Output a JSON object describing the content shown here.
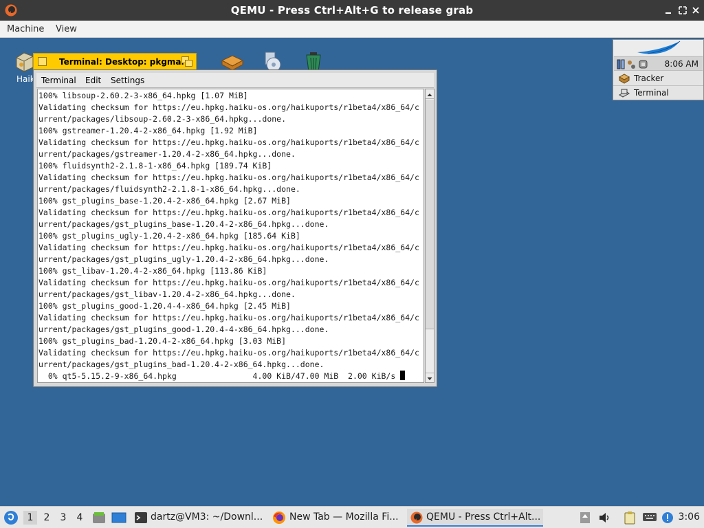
{
  "qemu": {
    "title": "QEMU - Press Ctrl+Alt+G to release grab",
    "menu": [
      "Machine",
      "View"
    ]
  },
  "desktop": {
    "icons": [
      {
        "name": "haiku-volume-icon",
        "label": "Haik"
      },
      {
        "name": "box-icon",
        "label": ""
      },
      {
        "name": "cd-icon",
        "label": ""
      },
      {
        "name": "trash-icon",
        "label": ""
      }
    ]
  },
  "terminal": {
    "title": "Terminal: Desktop: pkgman",
    "menu": [
      "Terminal",
      "Edit",
      "Settings"
    ],
    "lines": [
      "100% libsoup-2.60.2-3-x86_64.hpkg [1.07 MiB]",
      "Validating checksum for https://eu.hpkg.haiku-os.org/haikuports/r1beta4/x86_64/c",
      "urrent/packages/libsoup-2.60.2-3-x86_64.hpkg...done.",
      "100% gstreamer-1.20.4-2-x86_64.hpkg [1.92 MiB]",
      "Validating checksum for https://eu.hpkg.haiku-os.org/haikuports/r1beta4/x86_64/c",
      "urrent/packages/gstreamer-1.20.4-2-x86_64.hpkg...done.",
      "100% fluidsynth2-2.1.8-1-x86_64.hpkg [189.74 KiB]",
      "Validating checksum for https://eu.hpkg.haiku-os.org/haikuports/r1beta4/x86_64/c",
      "urrent/packages/fluidsynth2-2.1.8-1-x86_64.hpkg...done.",
      "100% gst_plugins_base-1.20.4-2-x86_64.hpkg [2.67 MiB]",
      "Validating checksum for https://eu.hpkg.haiku-os.org/haikuports/r1beta4/x86_64/c",
      "urrent/packages/gst_plugins_base-1.20.4-2-x86_64.hpkg...done.",
      "100% gst_plugins_ugly-1.20.4-2-x86_64.hpkg [185.64 KiB]",
      "Validating checksum for https://eu.hpkg.haiku-os.org/haikuports/r1beta4/x86_64/c",
      "urrent/packages/gst_plugins_ugly-1.20.4-2-x86_64.hpkg...done.",
      "100% gst_libav-1.20.4-2-x86_64.hpkg [113.86 KiB]",
      "Validating checksum for https://eu.hpkg.haiku-os.org/haikuports/r1beta4/x86_64/c",
      "urrent/packages/gst_libav-1.20.4-2-x86_64.hpkg...done.",
      "100% gst_plugins_good-1.20.4-4-x86_64.hpkg [2.45 MiB]",
      "Validating checksum for https://eu.hpkg.haiku-os.org/haikuports/r1beta4/x86_64/c",
      "urrent/packages/gst_plugins_good-1.20.4-4-x86_64.hpkg...done.",
      "100% gst_plugins_bad-1.20.4-2-x86_64.hpkg [3.03 MiB]",
      "Validating checksum for https://eu.hpkg.haiku-os.org/haikuports/r1beta4/x86_64/c",
      "urrent/packages/gst_plugins_bad-1.20.4-2-x86_64.hpkg...done.",
      "  0% qt5-5.15.2-9-x86_64.hpkg                4.00 KiB/47.00 MiB  2.00 KiB/s "
    ]
  },
  "deskbar": {
    "time": "8:06 AM",
    "items": [
      "Tracker",
      "Terminal"
    ]
  },
  "taskbar": {
    "workspaces": [
      "1",
      "2",
      "3",
      "4"
    ],
    "active_workspace": "1",
    "tasks": [
      {
        "icon": "terminal-icon",
        "label": "dartz@VM3: ~/Downl..."
      },
      {
        "icon": "firefox-icon",
        "label": "New Tab — Mozilla Fi..."
      },
      {
        "icon": "qemu-icon",
        "label": "QEMU - Press Ctrl+Alt..."
      }
    ],
    "active_task": 2,
    "clock": "3:06"
  },
  "colors": {
    "desktop": "#336698",
    "haiku_tab": "#ffcb00",
    "qemu_titlebar": "#3a3a3a",
    "accent": "#3b7fd4"
  }
}
